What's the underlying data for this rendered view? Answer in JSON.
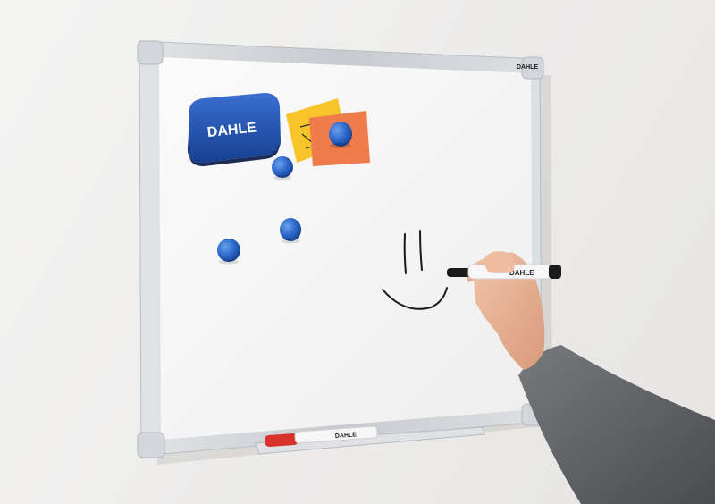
{
  "scene": {
    "subject": "whiteboard",
    "brand": {
      "eraser_logo": "DAHLE",
      "frame_logo": "DAHLE",
      "marker_logo": "DAHLE",
      "tray_marker_logo": "DAHLE"
    },
    "colors": {
      "wall": "#efeeed",
      "board": "#f6f6f6",
      "frame": "#cfd2d5",
      "eraser": "#1f4fa8",
      "magnet": "#2b66c9",
      "note_yellow": "#f7c52a",
      "note_orange": "#f07b4d",
      "marker_red": "#d8312b",
      "marker_white": "#f7f7f7",
      "sleeve": "#5d5f63",
      "skin": "#e9b496",
      "ink": "#1a1a1a"
    }
  }
}
